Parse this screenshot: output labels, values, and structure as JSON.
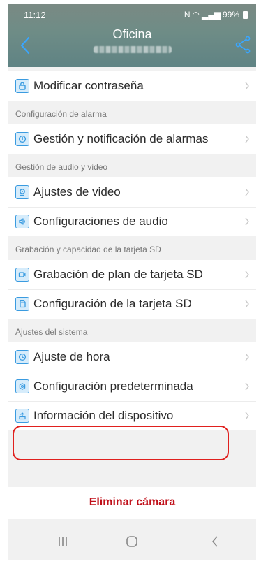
{
  "status_bar": {
    "time": "11:12",
    "battery": "99%",
    "icons": [
      "nfc-icon",
      "wifi-icon",
      "signal-icon",
      "battery-icon"
    ]
  },
  "header": {
    "title": "Oficina",
    "back_icon": "chevron-left-icon",
    "share_icon": "share-icon"
  },
  "items": {
    "modify_password": "Modificar contraseña",
    "alarm_management": "Gestión y notificación de alarmas",
    "video_settings": "Ajustes de video",
    "audio_settings": "Configuraciones de audio",
    "sd_recording_plan": "Grabación de plan de tarjeta SD",
    "sd_card_config": "Configuración de la tarjeta SD",
    "time_setting": "Ajuste de hora",
    "default_config": "Configuración predeterminada",
    "device_info": "Información del dispositivo"
  },
  "sections": {
    "alarm": "Configuración de alarma",
    "audio_video": "Gestión de audio y video",
    "sd": "Grabación y capacidad de la tarjeta SD",
    "system": "Ajustes del sistema"
  },
  "delete_camera": "Eliminar cámara",
  "colors": {
    "accent": "#3a9be0",
    "delete": "#c0101a",
    "highlight": "#e0201e",
    "header": "#6e8c86"
  }
}
